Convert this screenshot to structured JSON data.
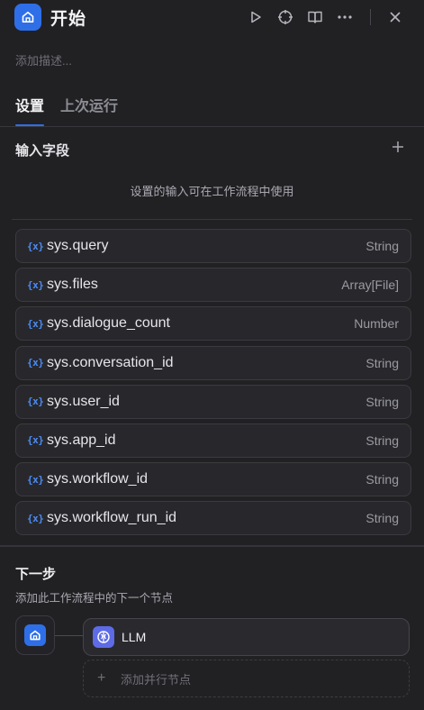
{
  "header": {
    "title": "开始",
    "icons": [
      "home-icon",
      "play-icon",
      "crosshair-icon",
      "book-icon",
      "more-icon",
      "close-icon"
    ]
  },
  "description_placeholder": "添加描述...",
  "tabs": [
    {
      "label": "设置",
      "active": true
    },
    {
      "label": "上次运行",
      "active": false
    }
  ],
  "inputs": {
    "title": "输入字段",
    "hint": "设置的输入可在工作流程中使用",
    "variables": [
      {
        "icon": "{x}",
        "name": "sys.query",
        "type": "String"
      },
      {
        "icon": "{x}",
        "name": "sys.files",
        "type": "Array[File]"
      },
      {
        "icon": "{x}",
        "name": "sys.dialogue_count",
        "type": "Number"
      },
      {
        "icon": "{x}",
        "name": "sys.conversation_id",
        "type": "String"
      },
      {
        "icon": "{x}",
        "name": "sys.user_id",
        "type": "String"
      },
      {
        "icon": "{x}",
        "name": "sys.app_id",
        "type": "String"
      },
      {
        "icon": "{x}",
        "name": "sys.workflow_id",
        "type": "String"
      },
      {
        "icon": "{x}",
        "name": "sys.workflow_run_id",
        "type": "String"
      }
    ]
  },
  "next_step": {
    "title": "下一步",
    "description": "添加此工作流程中的下一个节点",
    "node_label": "LLM",
    "add_parallel": "添加并行节点"
  },
  "colors": {
    "background": "#212124",
    "accent": "#2e6fe8",
    "variable_icon": "#4c8cf5",
    "llm_icon": "#5d6be6"
  }
}
